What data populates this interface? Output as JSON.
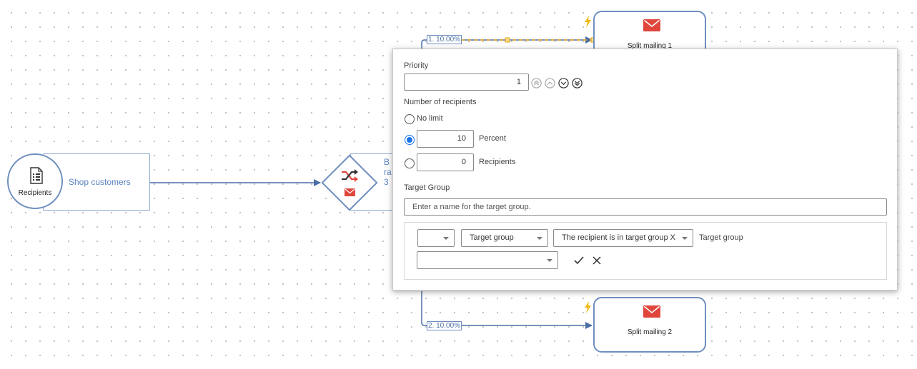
{
  "canvas": {
    "nodes": {
      "recipients": {
        "label": "Recipients",
        "description": "Shop customers"
      },
      "split": {
        "description_lines": [
          "B",
          "ra",
          "3"
        ]
      },
      "mailing1": {
        "label": "Split mailing 1"
      },
      "mailing2": {
        "label": "Split mailing 2"
      }
    },
    "connections": {
      "top_label": "1. 10.00%",
      "bottom_label": "2. 10.00%"
    }
  },
  "dialog": {
    "priority_label": "Priority",
    "priority_value": "1",
    "priority_buttons": [
      "move-to-top-icon",
      "move-up-icon",
      "move-down-icon",
      "move-to-bottom-icon"
    ],
    "number_label": "Number of recipients",
    "no_limit_label": "No limit",
    "percent_value": "10",
    "percent_label": "Percent",
    "recipients_value": "0",
    "recipients_label": "Recipients",
    "selected_option": "Percent",
    "target_group_label": "Target Group",
    "target_group_placeholder": "Enter a name for the target group.",
    "rule": {
      "operator_value": "",
      "field_value": "Target group",
      "condition_value": "The recipient is in target group X",
      "condition_suffix": "Target group",
      "target_value": ""
    }
  },
  "colors": {
    "connector": "#4a6fa5",
    "node_border": "#6f8fbf",
    "mail_icon": "#e0463c",
    "bolt": "#f2b90f",
    "radio_checked": "#1a73e8",
    "selection_handle": "#f2a31b"
  }
}
